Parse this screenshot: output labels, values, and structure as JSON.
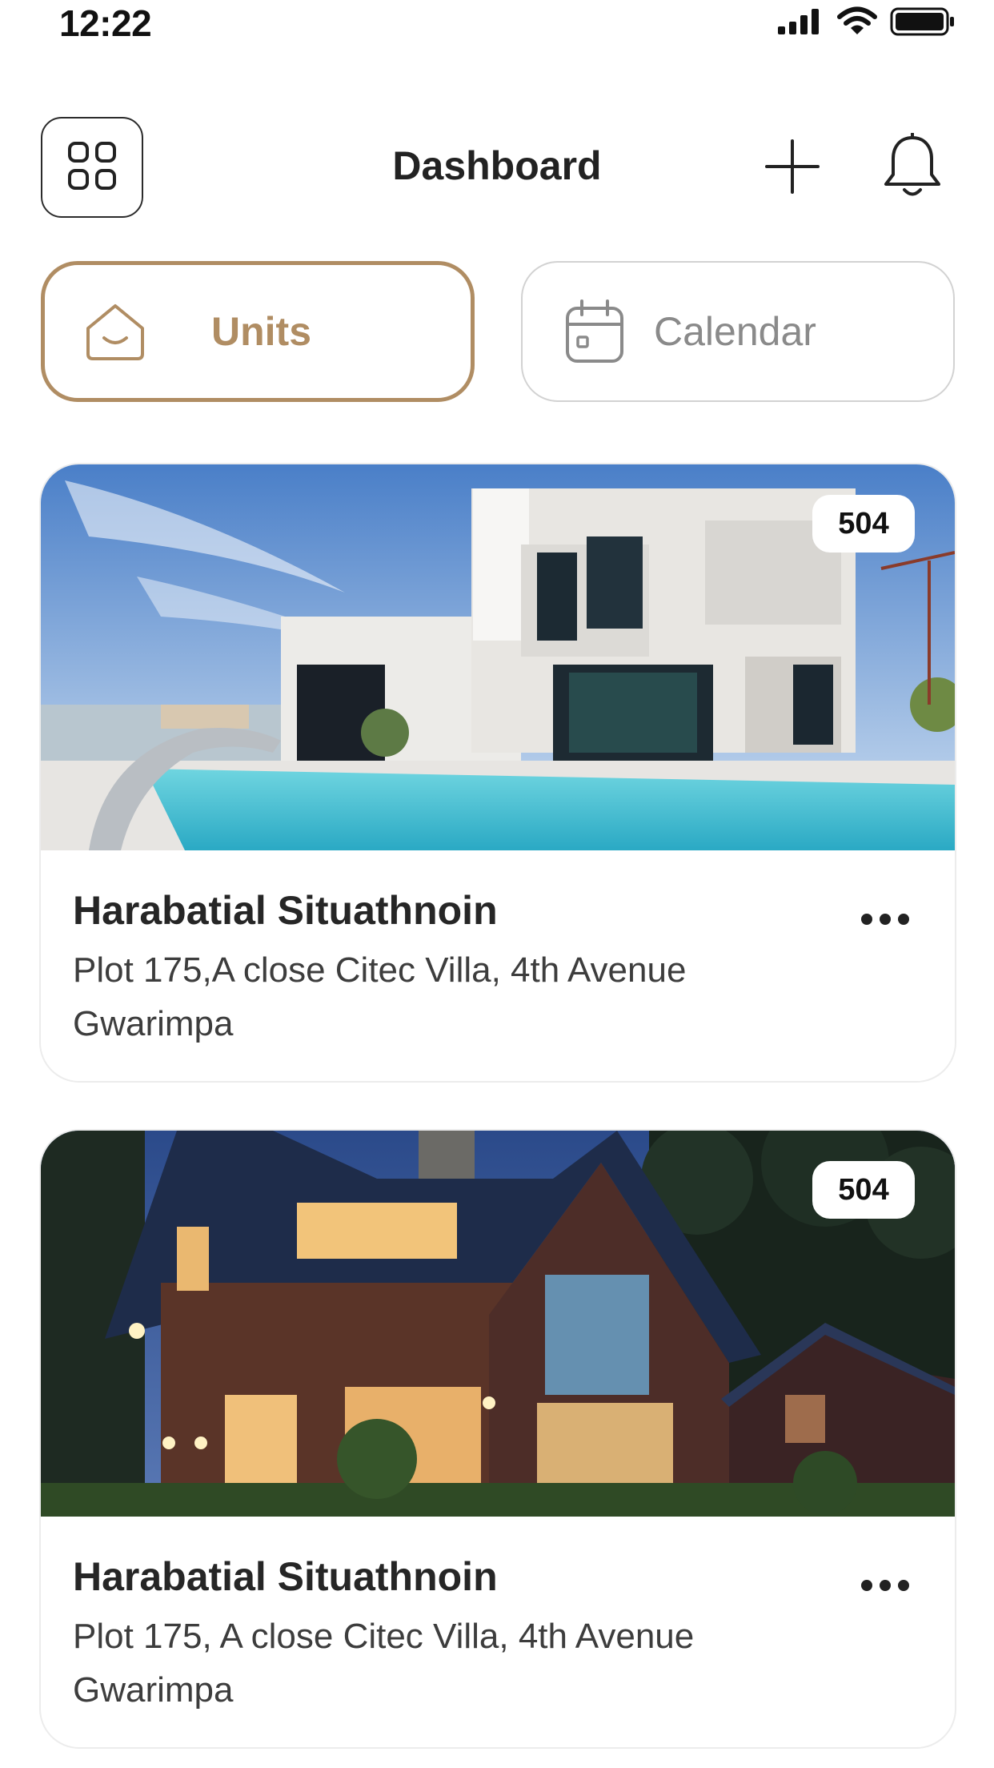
{
  "status_bar": {
    "time": "12:22",
    "icons": [
      "cellular-signal-icon",
      "wifi-icon",
      "battery-icon"
    ]
  },
  "header": {
    "title": "Dashboard",
    "menu_icon": "grid-icon",
    "add_icon": "plus-icon",
    "notifications_icon": "bell-icon"
  },
  "tabs": [
    {
      "label": "Units",
      "icon": "home-icon",
      "active": true
    },
    {
      "label": "Calendar",
      "icon": "calendar-icon",
      "active": false
    }
  ],
  "units": [
    {
      "badge": "504",
      "title": "Harabatial Situathnoin",
      "address": "Plot 175,A close Citec Villa, 4th Avenue Gwarimpa",
      "image": "modern-white-villa-with-pool"
    },
    {
      "badge": "504",
      "title": "Harabatial Situathnoin",
      "address": "Plot 175, A close Citec Villa, 4th Avenue Gwarimpa",
      "image": "wooden-house-at-dusk"
    }
  ],
  "colors": {
    "accent": "#b08d63",
    "text_primary": "#262626",
    "text_muted": "#8a8a8a",
    "border_light": "#d2d2d2"
  }
}
